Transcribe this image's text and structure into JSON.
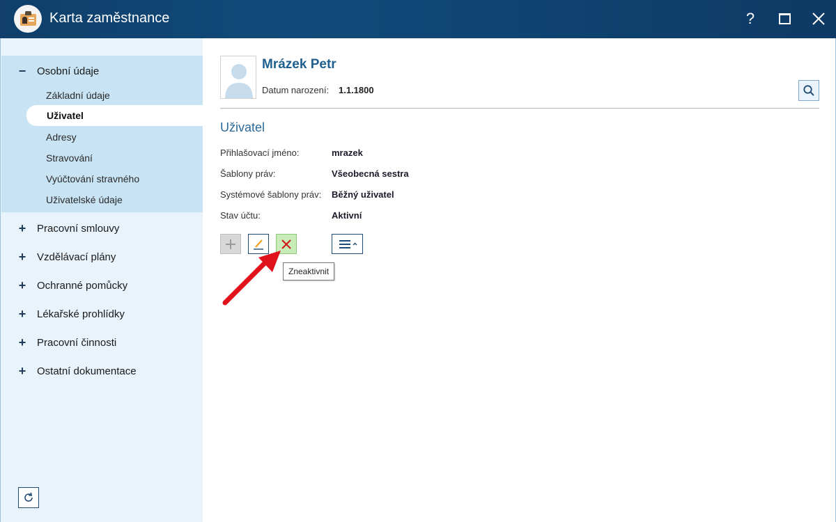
{
  "window": {
    "title": "Karta zaměstnance",
    "help_label": "?"
  },
  "sidebar": {
    "groups": [
      {
        "label": "Osobní údaje",
        "sign": "−",
        "expanded": true
      },
      {
        "label": "Pracovní smlouvy",
        "sign": "+"
      },
      {
        "label": "Vzdělávací plány",
        "sign": "+"
      },
      {
        "label": "Ochranné pomůcky",
        "sign": "+"
      },
      {
        "label": "Lékařské prohlídky",
        "sign": "+"
      },
      {
        "label": "Pracovní činnosti",
        "sign": "+"
      },
      {
        "label": "Ostatní dokumentace",
        "sign": "+"
      }
    ],
    "subitems": [
      "Základní údaje",
      "Uživatel",
      "Adresy",
      "Stravování",
      "Vyúčtování stravného",
      "Uživatelské údaje"
    ],
    "active_subitem": "Uživatel"
  },
  "employee": {
    "name": "Mrázek Petr",
    "dob_label": "Datum narození:",
    "dob_value": "1.1.1800"
  },
  "section": {
    "title": "Uživatel",
    "fields": [
      {
        "label": "Přihlašovací jméno:",
        "value": "mrazek"
      },
      {
        "label": "Šablony práv:",
        "value": "Všeobecná sestra"
      },
      {
        "label": "Systémové šablony práv:",
        "value": "Běžný uživatel"
      },
      {
        "label": "Stav účtu:",
        "value": "Aktivní"
      }
    ]
  },
  "tooltip": "Zneaktivnit",
  "colors": {
    "titlebar": "#114a7a",
    "sidebar_bg": "#e9f3fb",
    "group_open_bg": "#c7e3f4",
    "accent_text": "#1e5f8f",
    "deactivate_bg": "#c8ecb8",
    "arrow": "#e0121b"
  },
  "icons": {
    "app": "employee-card-icon",
    "help": "help-icon",
    "maximize": "maximize-icon",
    "close": "close-icon",
    "search": "search-icon",
    "refresh": "refresh-icon",
    "add": "plus-icon",
    "edit": "pencil-icon",
    "deactivate": "x-icon",
    "menu": "hamburger-menu-icon"
  }
}
